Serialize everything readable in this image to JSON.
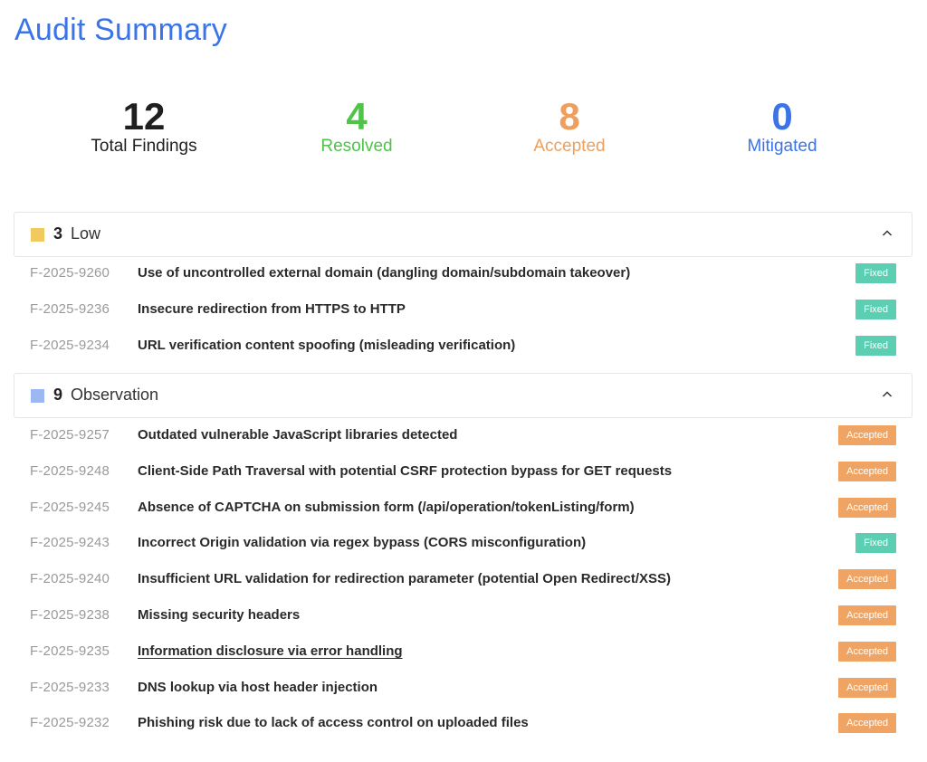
{
  "page": {
    "title": "Audit Summary"
  },
  "stats": [
    {
      "value": "12",
      "label": "Total Findings",
      "color": "#1f1f1f"
    },
    {
      "value": "4",
      "label": "Resolved",
      "color": "#4fc34a"
    },
    {
      "value": "8",
      "label": "Accepted",
      "color": "#ee9f5e"
    },
    {
      "value": "0",
      "label": "Mitigated",
      "color": "#3b74e8"
    }
  ],
  "sections": [
    {
      "count": "3",
      "name": "Low",
      "swatch_color": "#f0c95f",
      "findings": [
        {
          "id": "F-2025-9260",
          "title": "Use of uncontrolled external domain (dangling domain/subdomain takeover)",
          "status": "Fixed"
        },
        {
          "id": "F-2025-9236",
          "title": "Insecure redirection from HTTPS to HTTP",
          "status": "Fixed"
        },
        {
          "id": "F-2025-9234",
          "title": "URL verification content spoofing (misleading verification)",
          "status": "Fixed"
        }
      ]
    },
    {
      "count": "9",
      "name": "Observation",
      "swatch_color": "#9bb8f0",
      "findings": [
        {
          "id": "F-2025-9257",
          "title": "Outdated vulnerable JavaScript libraries detected",
          "status": "Accepted"
        },
        {
          "id": "F-2025-9248",
          "title": "Client-Side Path Traversal with potential CSRF protection bypass for GET requests",
          "status": "Accepted"
        },
        {
          "id": "F-2025-9245",
          "title": "Absence of CAPTCHA on submission form (/api/operation/tokenListing/form)",
          "status": "Accepted"
        },
        {
          "id": "F-2025-9243",
          "title": "Incorrect Origin validation via regex bypass (CORS misconfiguration)",
          "status": "Fixed"
        },
        {
          "id": "F-2025-9240",
          "title": "Insufficient URL validation for redirection parameter (potential Open Redirect/XSS)",
          "status": "Accepted"
        },
        {
          "id": "F-2025-9238",
          "title": "Missing security headers",
          "status": "Accepted"
        },
        {
          "id": "F-2025-9235",
          "title": "Information disclosure via error handling",
          "status": "Accepted"
        },
        {
          "id": "F-2025-9233",
          "title": "DNS lookup via host header injection",
          "status": "Accepted"
        },
        {
          "id": "F-2025-9232",
          "title": "Phishing risk due to lack of access control on uploaded files",
          "status": "Accepted"
        }
      ]
    }
  ],
  "icons": {
    "collapse": "chevron-up-icon"
  }
}
